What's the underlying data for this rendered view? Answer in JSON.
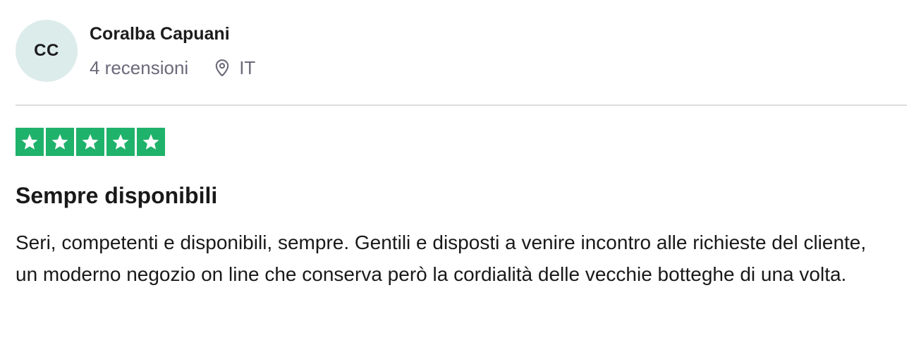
{
  "consumer": {
    "initials": "CC",
    "name": "Coralba Capuani",
    "reviews_count": "4 recensioni",
    "country": "IT",
    "avatar_color": "#dcecea"
  },
  "rating": {
    "stars": 5,
    "max_stars": 5,
    "star_color": "#1fb26b",
    "icon": "star-icon"
  },
  "review": {
    "title": "Sempre disponibili",
    "body": "Seri, competenti e disponibili, sempre. Gentili e disposti a venire incontro alle richieste del cliente, un moderno negozio on line che conserva però la cordialità delle vecchie botteghe di una volta."
  },
  "icons": {
    "location": "location-pin-icon"
  }
}
